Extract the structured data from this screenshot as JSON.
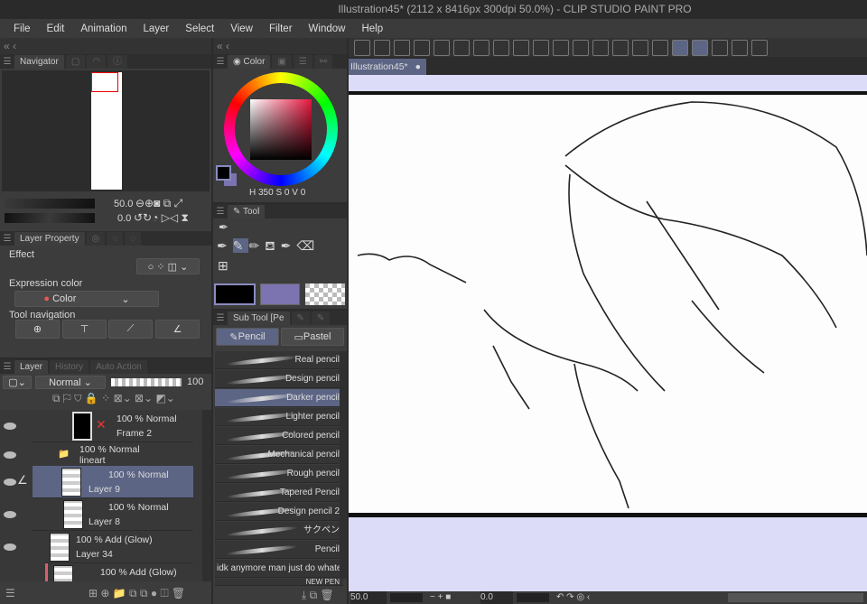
{
  "window": {
    "title": "Illustration45* (2112 x 8416px 300dpi 50.0%)  - CLIP STUDIO PAINT PRO"
  },
  "menu": [
    "File",
    "Edit",
    "Animation",
    "Layer",
    "Select",
    "View",
    "Filter",
    "Window",
    "Help"
  ],
  "navigator": {
    "tabs": [
      "Navigator"
    ],
    "zoom": "50.0",
    "rotation": "0.0"
  },
  "layer_property": {
    "tab": "Layer Property",
    "effect_label": "Effect",
    "expression_color_label": "Expression color",
    "expression_color_value": "Color",
    "tool_navigation_label": "Tool navigation"
  },
  "layer_panel": {
    "tabs": [
      "Layer",
      "History",
      "Auto Action"
    ],
    "blend_mode": "Normal",
    "opacity": "100",
    "layers": [
      {
        "mode": "100 % Normal",
        "name": "Frame 2"
      },
      {
        "mode": "100 % Normal",
        "name": "lineart"
      },
      {
        "mode": "100 % Normal",
        "name": "Layer 9"
      },
      {
        "mode": "100 % Normal",
        "name": "Layer 8"
      },
      {
        "mode": "100 % Add (Glow)",
        "name": "Layer 34"
      },
      {
        "mode": "100 % Add (Glow)",
        "name": ""
      }
    ]
  },
  "color": {
    "tab": "Color",
    "h": "350",
    "s": "0",
    "v": "0",
    "main_color": "#000000",
    "sub_color": "#7b74b0"
  },
  "tool": {
    "tab": "Tool"
  },
  "subtool": {
    "tab": "Sub Tool [Pe",
    "groups": [
      "Pencil",
      "Pastel"
    ],
    "items": [
      "Real pencil",
      "Design pencil",
      "Darker pencil",
      "Lighter pencil",
      "Colored pencil",
      "Mechanical pencil",
      "Rough pencil",
      "Tapered Pencil",
      "Design pencil 2",
      "サクペン",
      "Pencil",
      "idk anymore man just do whate",
      "NEW PEN"
    ],
    "selected": "Darker pencil"
  },
  "canvas": {
    "tab": "Illustration45*",
    "zoom": "50.0",
    "angle": "0.0",
    "background": "#dcdcf8"
  }
}
